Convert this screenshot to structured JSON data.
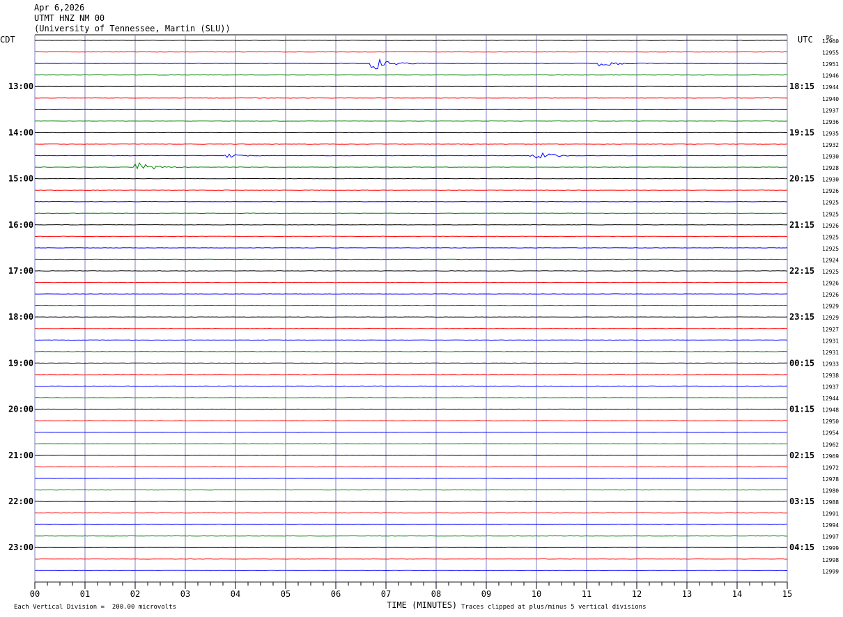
{
  "header": {
    "date": "Apr 6,2026",
    "station": "UTMT HNZ NM 00",
    "network": "(University of Tennessee, Martin (SLU))"
  },
  "left_label": "CDT",
  "right_label": "UTC",
  "dc_label": "DC",
  "footer": {
    "scale": "Each Vertical Division =  200.00 microvolts",
    "xlabel": "TIME (MINUTES)",
    "clip": "Traces clipped at plus/minus 5 vertical divisions"
  },
  "chart_data": {
    "type": "line",
    "title": "UTMT HNZ NM 00",
    "xlabel": "TIME (MINUTES)",
    "ylabel": "",
    "xlim": [
      0,
      15
    ],
    "x_ticks": [
      "00",
      "01",
      "02",
      "03",
      "04",
      "05",
      "06",
      "07",
      "08",
      "09",
      "10",
      "11",
      "12",
      "13",
      "14",
      "15"
    ],
    "left_hour_labels": [
      "13:00",
      "14:00",
      "15:00",
      "16:00",
      "17:00",
      "18:00",
      "19:00",
      "20:00",
      "21:00",
      "22:00",
      "23:00"
    ],
    "right_hour_labels": [
      "18:15",
      "19:15",
      "20:15",
      "21:15",
      "22:15",
      "23:15",
      "00:15",
      "01:15",
      "02:15",
      "03:15",
      "04:15"
    ],
    "trace_colors": [
      "#000000",
      "#ff0000",
      "#0000ff",
      "#008000"
    ],
    "dc_offsets": [
      "12960",
      "12955",
      "12951",
      "12946",
      "12944",
      "12940",
      "12937",
      "12936",
      "12935",
      "12932",
      "12930",
      "12928",
      "12930",
      "12926",
      "12925",
      "12925",
      "12926",
      "12925",
      "12925",
      "12924",
      "12925",
      "12926",
      "12926",
      "12929",
      "12929",
      "12927",
      "12931",
      "12931",
      "12933",
      "12938",
      "12937",
      "12944",
      "12948",
      "12950",
      "12954",
      "12962",
      "12969",
      "12972",
      "12978",
      "12980",
      "12988",
      "12991",
      "12994",
      "12997",
      "12999",
      "12998",
      "12999"
    ],
    "events": [
      {
        "trace": 2,
        "minute": 6.8,
        "amplitude": "large"
      },
      {
        "trace": 2,
        "minute": 11.35,
        "amplitude": "medium"
      },
      {
        "trace": 10,
        "minute": 3.9,
        "amplitude": "small"
      },
      {
        "trace": 10,
        "minute": 9.95,
        "amplitude": "large"
      },
      {
        "trace": 11,
        "minute": 2.1,
        "amplitude": "large"
      }
    ]
  }
}
